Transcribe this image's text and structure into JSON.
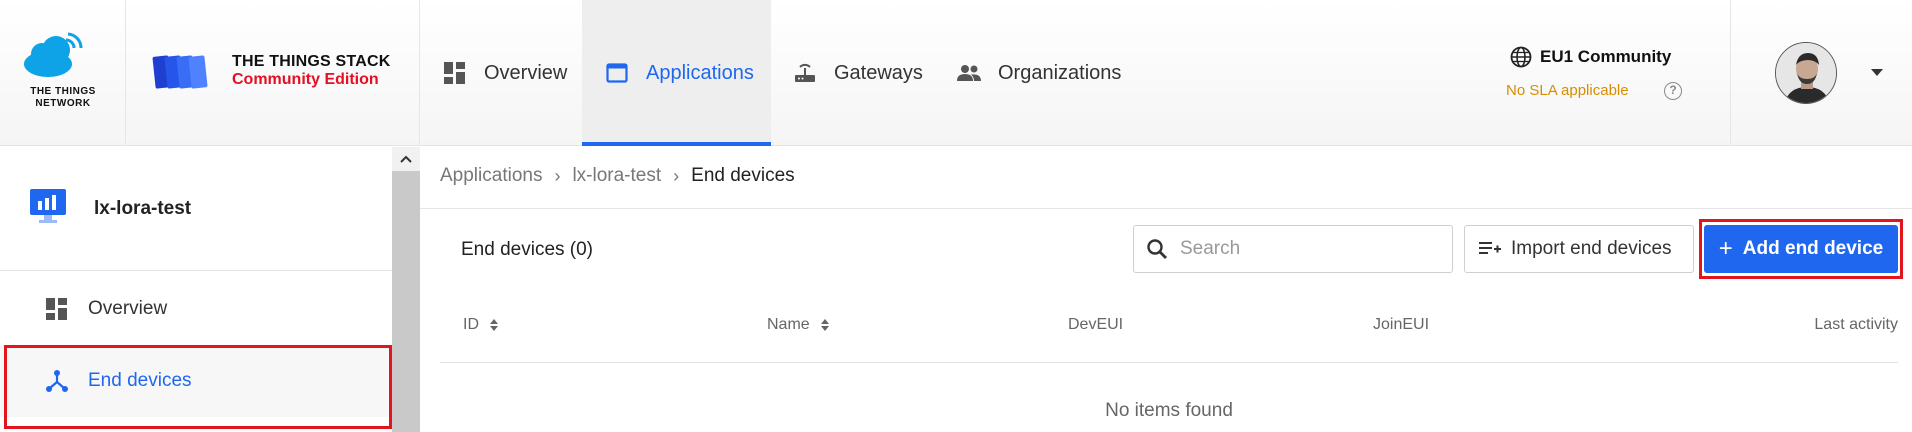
{
  "header": {
    "ttn_logo_text": "THE THINGS NETWORK",
    "stack_title": "THE THINGS STACK",
    "stack_subtitle": "Community Edition",
    "nav": {
      "overview": "Overview",
      "applications": "Applications",
      "gateways": "Gateways",
      "organizations": "Organizations"
    },
    "region": "EU1 Community",
    "sla": "No SLA applicable",
    "help_symbol": "?"
  },
  "sidebar": {
    "app_name": "lx-lora-test",
    "items": [
      {
        "label": "Overview",
        "icon": "dashboard-icon"
      },
      {
        "label": "End devices",
        "icon": "device-nodes-icon",
        "active": true
      }
    ]
  },
  "breadcrumb": {
    "items": [
      "Applications",
      "lx-lora-test",
      "End devices"
    ]
  },
  "main": {
    "title": "End devices (0)",
    "search_placeholder": "Search",
    "import_label": "Import end devices",
    "add_label": "Add end device",
    "columns": [
      "ID",
      "Name",
      "DevEUI",
      "JoinEUI",
      "Last activity"
    ],
    "empty_text": "No items found"
  },
  "colors": {
    "accent": "#1f67ef",
    "brand_red": "#e40f23",
    "sla_orange": "#d68e00",
    "highlight_red": "#e0151e"
  }
}
